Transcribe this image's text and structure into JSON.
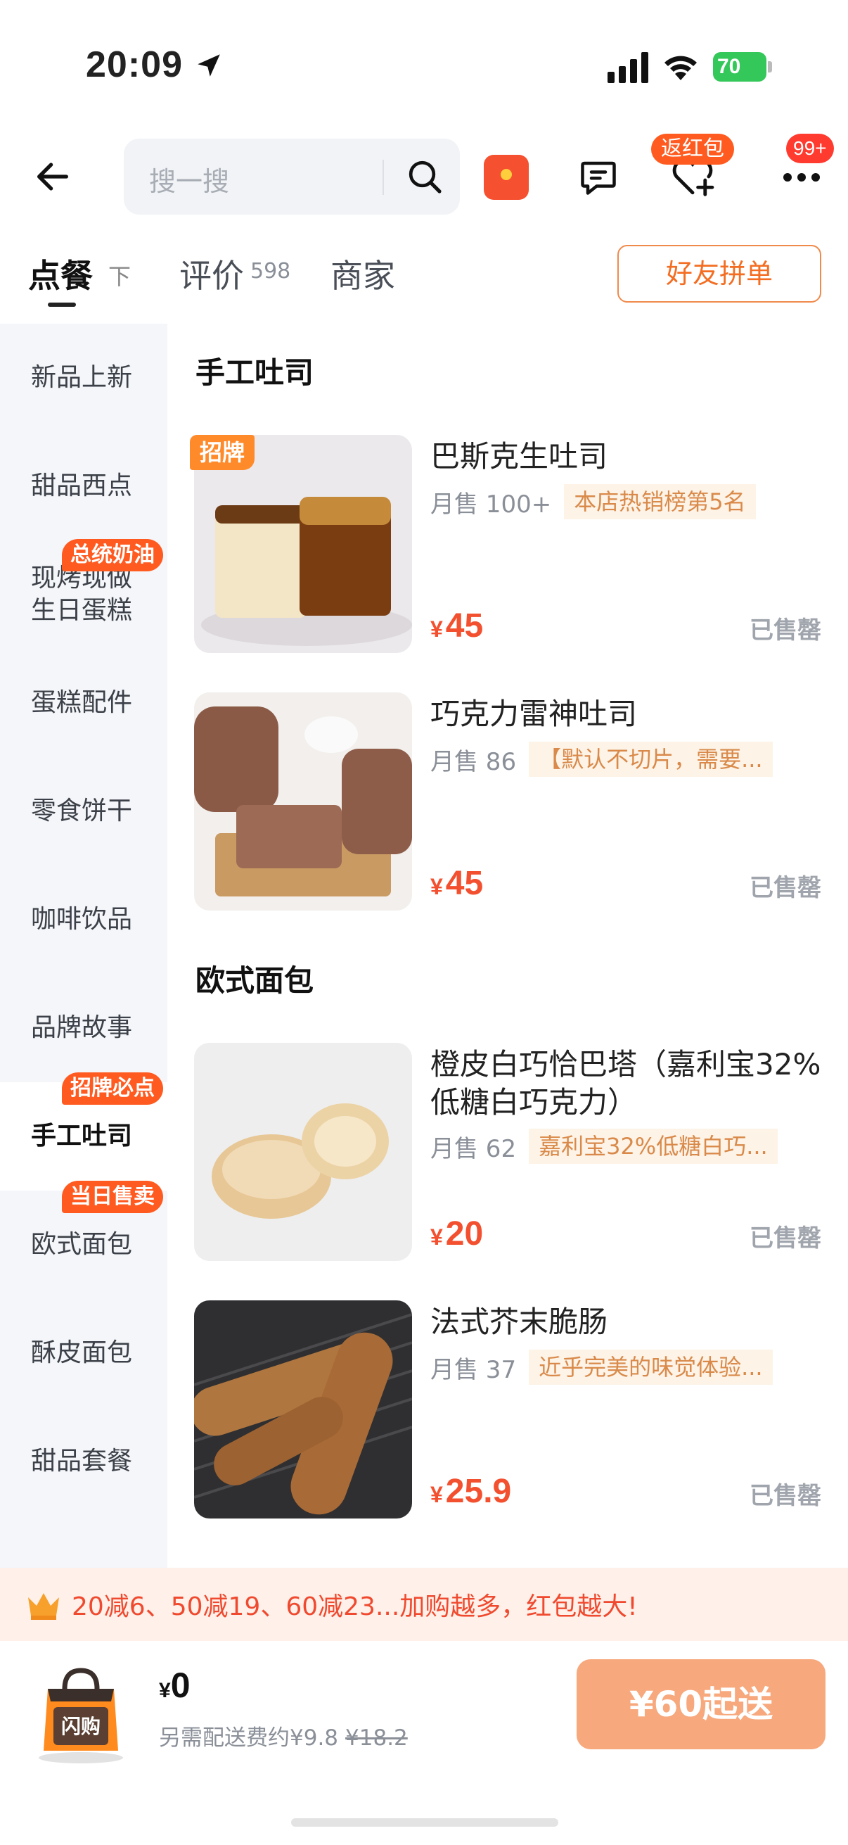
{
  "status_bar": {
    "time": "20:09",
    "battery": "70"
  },
  "nav": {
    "search_placeholder": "搜一搜",
    "favorite_badge": "返红包",
    "more_badge": "99+"
  },
  "tabs": {
    "order": "点餐",
    "order_sort": "下",
    "review": "评价",
    "review_count": "598",
    "shop": "商家",
    "group_order": "好友拼单"
  },
  "sidebar": {
    "items": [
      {
        "label": "新品上新",
        "badge": ""
      },
      {
        "label": "甜品西点",
        "badge": ""
      },
      {
        "label": "现烤现做\n生日蛋糕",
        "badge": "总统奶油"
      },
      {
        "label": "蛋糕配件",
        "badge": ""
      },
      {
        "label": "零食饼干",
        "badge": ""
      },
      {
        "label": "咖啡饮品",
        "badge": ""
      },
      {
        "label": "品牌故事",
        "badge": ""
      },
      {
        "label": "手工吐司",
        "badge": "招牌必点",
        "active": true
      },
      {
        "label": "欧式面包",
        "badge": "当日售卖"
      },
      {
        "label": "酥皮面包",
        "badge": ""
      },
      {
        "label": "甜品套餐",
        "badge": ""
      }
    ]
  },
  "sections": [
    {
      "title": "手工吐司",
      "items": [
        {
          "tag": "招牌",
          "name": "巴斯克生吐司",
          "sales": "月售 100+",
          "tagline": "本店热销榜第5名",
          "currency": "¥",
          "price": "45",
          "status": "已售罄"
        },
        {
          "tag": "",
          "name": "巧克力雷神吐司",
          "sales": "月售 86",
          "tagline": "【默认不切片，需要...",
          "currency": "¥",
          "price": "45",
          "status": "已售罄"
        }
      ]
    },
    {
      "title": "欧式面包",
      "items": [
        {
          "tag": "",
          "name": "橙皮白巧恰巴塔（嘉利宝32%低糖白巧克力）",
          "sales": "月售 62",
          "tagline": "嘉利宝32%低糖白巧...",
          "currency": "¥",
          "price": "20",
          "status": "已售罄"
        },
        {
          "tag": "",
          "name": "法式芥末脆肠",
          "sales": "月售 37",
          "tagline": "近乎完美的味觉体验...",
          "currency": "¥",
          "price": "25.9",
          "status": "已售罄"
        }
      ]
    }
  ],
  "promo": {
    "text": "20减6、50减19、60减23...加购越多，红包越大!"
  },
  "cart": {
    "bag_label": "闪购",
    "currency": "¥",
    "total": "0",
    "delivery_fee": "另需配送费约¥9.8",
    "delivery_fee_original": "¥18.2",
    "min_order": "¥60起送"
  },
  "colors": {
    "accent": "#f3502f",
    "badge": "#ff5a1f",
    "tagline_bg": "#fdf3e7",
    "min_order_btn": "#f7a87c"
  }
}
